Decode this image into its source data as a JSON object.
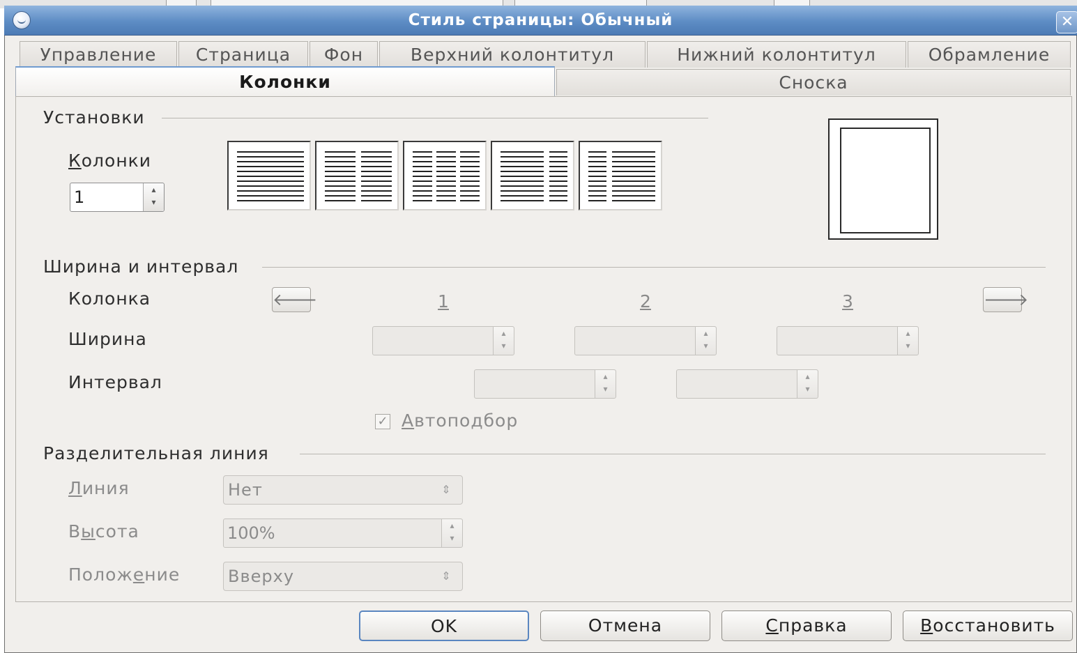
{
  "dialog": {
    "title": "Стиль страницы: Обычный",
    "close_glyph": "✕"
  },
  "tabs": {
    "row1": [
      "Управление",
      "Страница",
      "Фон",
      "Верхний колонтитул",
      "Нижний колонтитул",
      "Обрамление"
    ],
    "row2": [
      "Колонки",
      "Сноска"
    ],
    "active": "Колонки"
  },
  "settings": {
    "section_title": "Установки",
    "columns_label": "Колонки",
    "columns_value": "1",
    "presets": [
      "one-column",
      "two-columns",
      "three-columns",
      "two-columns-left-wide",
      "two-columns-right-wide"
    ]
  },
  "width_spacing": {
    "section_title": "Ширина и интервал",
    "column_label": "Колонка",
    "width_label": "Ширина",
    "spacing_label": "Интервал",
    "column_numbers": [
      "1",
      "2",
      "3"
    ],
    "left_arrow": "🡐",
    "right_arrow": "🡒",
    "autofit_label": "Автоподбор",
    "autofit_checked": true
  },
  "separator": {
    "section_title": "Разделительная линия",
    "line_label": "Линия",
    "line_value": "Нет",
    "height_label": "Высота",
    "height_value": "100%",
    "position_label": "Положение",
    "position_value": "Вверху"
  },
  "buttons": {
    "ok": "OK",
    "cancel": "Отмена",
    "help": "Справка",
    "reset": "Восстановить"
  },
  "colors": {
    "titlebar": "#5d8cc4",
    "dialog_bg": "#f1efec",
    "default_button_border": "#5a86c0"
  }
}
